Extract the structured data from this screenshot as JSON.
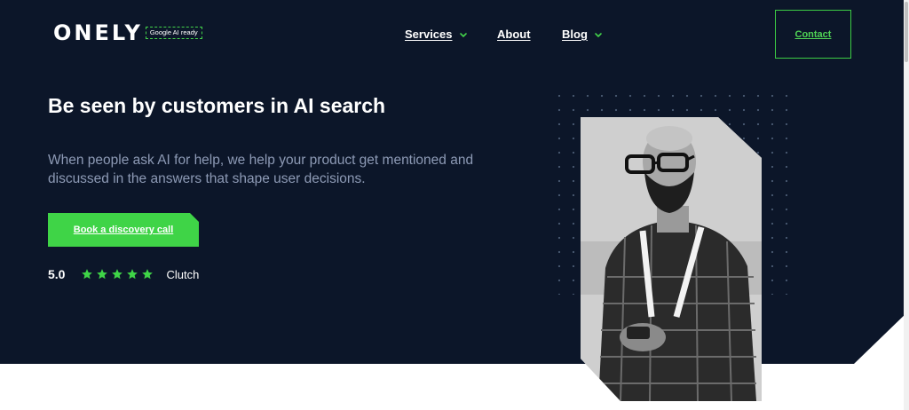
{
  "header": {
    "logo_text": "ONELY",
    "logo_badge": "Google AI ready",
    "nav": [
      {
        "label": "Services",
        "has_dropdown": true
      },
      {
        "label": "About",
        "has_dropdown": false
      },
      {
        "label": "Blog",
        "has_dropdown": true
      }
    ],
    "contact_label": "Contact"
  },
  "hero": {
    "headline": "Be seen by customers in AI search",
    "subheadline": "When people ask AI for help, we help your product get mentioned and discussed in the answers that shape user decisions.",
    "cta_label": "Book a discovery call",
    "rating": {
      "score": "5.0",
      "stars": 5,
      "source": "Clutch"
    }
  },
  "colors": {
    "background": "#0c1629",
    "accent": "#3fd447",
    "subtext": "#8d9ab5"
  },
  "icons": [
    "chevron-down-icon",
    "star-icon"
  ]
}
